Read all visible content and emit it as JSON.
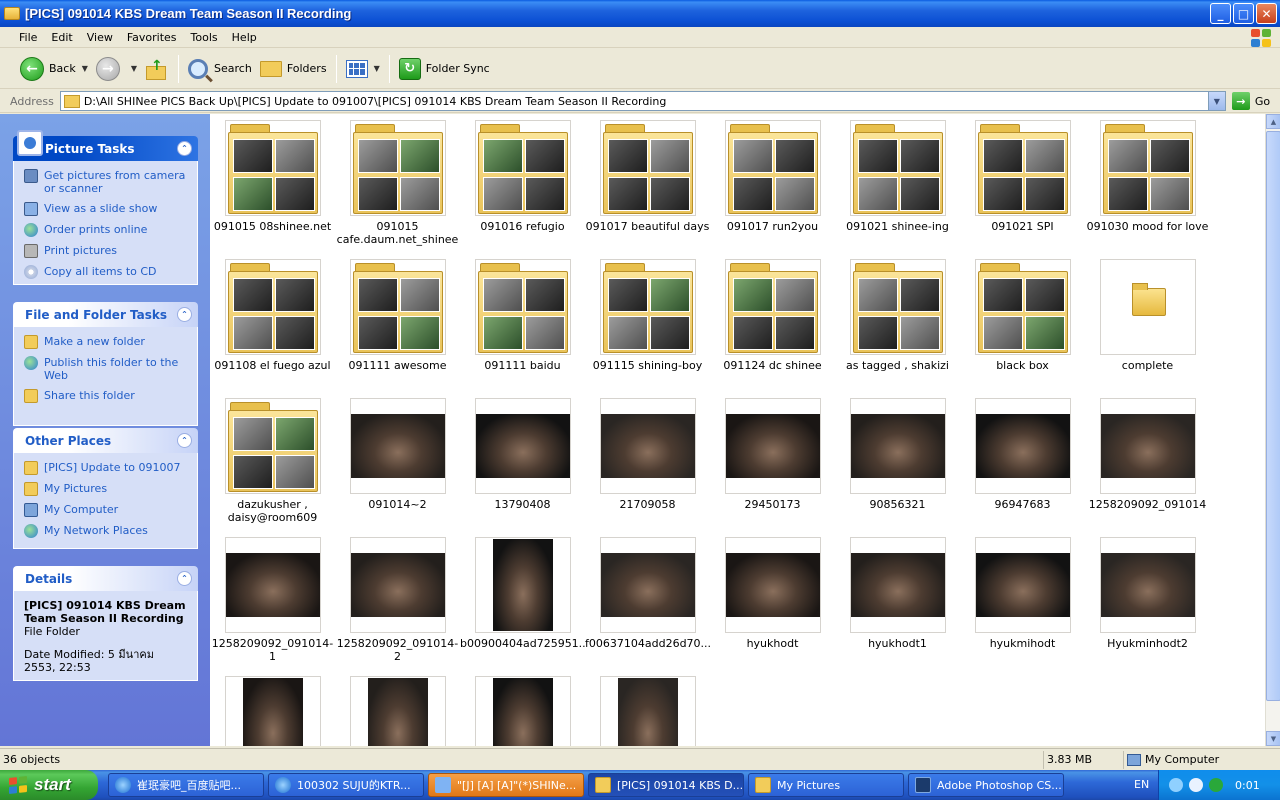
{
  "window": {
    "title": "[PICS] 091014 KBS Dream Team Season II Recording",
    "buttons": {
      "minimize": "_",
      "maximize": "□",
      "close": "✕"
    }
  },
  "menu": [
    "File",
    "Edit",
    "View",
    "Favorites",
    "Tools",
    "Help"
  ],
  "toolbar": {
    "back": "Back",
    "search": "Search",
    "folders": "Folders",
    "folder_sync": "Folder Sync"
  },
  "address": {
    "label": "Address",
    "value": "D:\\All SHINee PICS Back Up\\[PICS] Update to 091007\\[PICS] 091014 KBS Dream Team Season II Recording",
    "go": "Go"
  },
  "panels": {
    "picture_tasks": {
      "title": "Picture Tasks",
      "items": [
        {
          "label": "Get pictures from camera or scanner",
          "icon": "camera-icon"
        },
        {
          "label": "View as a slide show",
          "icon": "slideshow-icon"
        },
        {
          "label": "Order prints online",
          "icon": "globe-icon"
        },
        {
          "label": "Print pictures",
          "icon": "printer-icon"
        },
        {
          "label": "Copy all items to CD",
          "icon": "cd-icon"
        }
      ]
    },
    "file_folder_tasks": {
      "title": "File and Folder Tasks",
      "items": [
        {
          "label": "Make a new folder",
          "icon": "new-folder-icon"
        },
        {
          "label": "Publish this folder to the Web",
          "icon": "globe-icon"
        },
        {
          "label": "Share this folder",
          "icon": "share-icon"
        }
      ]
    },
    "other_places": {
      "title": "Other Places",
      "items": [
        {
          "label": "[PICS] Update to 091007",
          "icon": "folder-icon"
        },
        {
          "label": "My Pictures",
          "icon": "folder-icon"
        },
        {
          "label": "My Computer",
          "icon": "computer-icon"
        },
        {
          "label": "My Network Places",
          "icon": "network-icon"
        }
      ]
    },
    "details": {
      "title": "Details",
      "name": "[PICS] 091014 KBS Dream Team Season II Recording",
      "type": "File Folder",
      "modified": "Date Modified: 5 มีนาคม 2553, 22:53"
    }
  },
  "files": [
    {
      "name": "091015 08shinee.net",
      "kind": "folder"
    },
    {
      "name": "091015 cafe.daum.net_shinee",
      "kind": "folder"
    },
    {
      "name": "091016 refugio",
      "kind": "folder"
    },
    {
      "name": "091017 beautiful days",
      "kind": "folder"
    },
    {
      "name": "091017 run2you",
      "kind": "folder"
    },
    {
      "name": "091021 shinee-ing",
      "kind": "folder"
    },
    {
      "name": "091021 SPI",
      "kind": "folder"
    },
    {
      "name": "091030 mood for love",
      "kind": "folder"
    },
    {
      "name": "091108 el fuego azul",
      "kind": "folder"
    },
    {
      "name": "091111 awesome",
      "kind": "folder"
    },
    {
      "name": "091111 baidu",
      "kind": "folder"
    },
    {
      "name": "091115 shining-boy",
      "kind": "folder"
    },
    {
      "name": "091124 dc shinee",
      "kind": "folder"
    },
    {
      "name": "as tagged , shakizi",
      "kind": "folder"
    },
    {
      "name": "black box",
      "kind": "folder"
    },
    {
      "name": "complete",
      "kind": "empty-folder"
    },
    {
      "name": "dazukusher , daisy@room609",
      "kind": "folder"
    },
    {
      "name": "091014~2",
      "kind": "photo-wide"
    },
    {
      "name": "13790408",
      "kind": "photo-wide"
    },
    {
      "name": "21709058",
      "kind": "photo-wide"
    },
    {
      "name": "29450173",
      "kind": "photo-wide"
    },
    {
      "name": "90856321",
      "kind": "photo-wide"
    },
    {
      "name": "96947683",
      "kind": "photo-wide"
    },
    {
      "name": "1258209092_091014",
      "kind": "photo-wide"
    },
    {
      "name": "1258209092_091014-1",
      "kind": "photo-wide"
    },
    {
      "name": "1258209092_091014-2",
      "kind": "photo-wide"
    },
    {
      "name": "b00900404ad725951...",
      "kind": "photo-tall"
    },
    {
      "name": "f00637104add26d70...",
      "kind": "photo-wide"
    },
    {
      "name": "hyukhodt",
      "kind": "photo-wide"
    },
    {
      "name": "hyukhodt1",
      "kind": "photo-wide"
    },
    {
      "name": "hyukmihodt",
      "kind": "photo-wide"
    },
    {
      "name": "Hyukminhodt2",
      "kind": "photo-wide"
    },
    {
      "name": "",
      "kind": "photo-tall"
    },
    {
      "name": "",
      "kind": "photo-tall"
    },
    {
      "name": "",
      "kind": "photo-tall"
    },
    {
      "name": "",
      "kind": "photo-tall"
    }
  ],
  "status": {
    "objects": "36 objects",
    "size": "3.83 MB",
    "location": "My Computer"
  },
  "taskbar": {
    "start": "start",
    "buttons": [
      {
        "label": "崔珉豪吧_百度贴吧...",
        "icon": "ie-icon"
      },
      {
        "label": "100302 SUJU的KTR...",
        "icon": "ie-icon"
      },
      {
        "label": "\"[J] [A] [A]\"(*)SHINe...",
        "icon": "chat-icon"
      },
      {
        "label": "[PICS] 091014 KBS D...",
        "icon": "folder-icon"
      },
      {
        "label": "My Pictures",
        "icon": "folder-icon"
      },
      {
        "label": "Adobe Photoshop CS...",
        "icon": "photoshop-icon"
      }
    ],
    "lang": "EN",
    "clock": "0:01"
  }
}
